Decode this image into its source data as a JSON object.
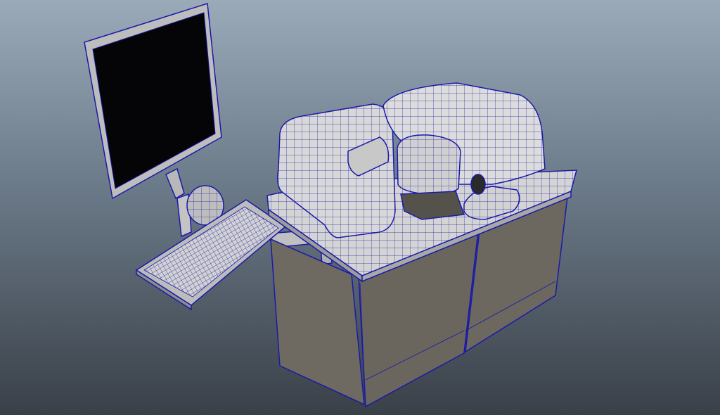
{
  "viewport": {
    "background_top": "#9aaab9",
    "background_bottom": "#3a4048",
    "wireframe_color": "#1a1aa8",
    "surface_light": "#d6d6d6",
    "surface_dark": "#6a665e"
  },
  "scene": {
    "objects": [
      "monitor",
      "monitor-arm",
      "keyboard",
      "keyboard-arm",
      "instrument-cabinet",
      "instrument-top-unit"
    ]
  }
}
